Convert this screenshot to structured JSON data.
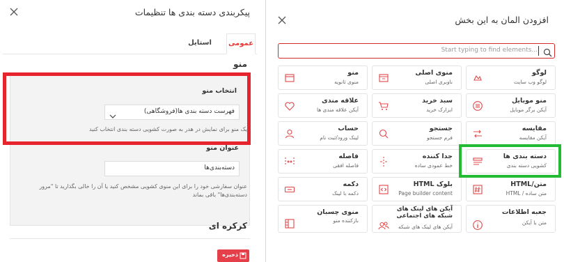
{
  "left_panel": {
    "title": "پیکربندی دسته بندی ها تنظیمات",
    "tabs": [
      {
        "label": "عمومی",
        "active": true
      },
      {
        "label": "استایل",
        "active": false
      }
    ],
    "menu_section": {
      "title": "منو",
      "select_label": "انتخاب منو",
      "select_value": "فهرست دسته بندی ها(فروشگاهی)",
      "select_help": "یک منو برای نمایش در هدر به صورت کشویی دسته بندی انتخاب کنید",
      "title_label": "عنوان منو",
      "title_value": "دسته‌بندی‌ها",
      "title_help": "عنوان سفارشی خود را برای این منوی کشویی مشخص کنید یا آن را خالی بگذارید تا \"مرور دسته‌بندی‌ها\" باقی بماند"
    },
    "hamburger_section": {
      "title": "کرکره ای"
    },
    "save_label": "ذخیره"
  },
  "right_panel": {
    "title": "افزودن المان به این بخش",
    "search": {
      "placeholder": "Start typing to find elements...",
      "value": ""
    },
    "elements": [
      {
        "title": "لوگو",
        "subtitle": "لوگو وب سایت",
        "icon": "logo-icon"
      },
      {
        "title": "منوی اصلی",
        "subtitle": "ناوبری اصلی",
        "icon": "main-menu-icon"
      },
      {
        "title": "منو",
        "subtitle": "منوی ثانویه",
        "icon": "menu-icon"
      },
      {
        "title": "منو موبایل",
        "subtitle": "آیکن برگر موبایل",
        "icon": "mobile-menu-icon"
      },
      {
        "title": "سبد خرید",
        "subtitle": "ابزارک خرید",
        "icon": "cart-icon"
      },
      {
        "title": "علاقه مندی",
        "subtitle": "آیکن علاقه مندی ها",
        "icon": "heart-icon"
      },
      {
        "title": "مقایسه",
        "subtitle": "آیکن مقایسه",
        "icon": "compare-icon"
      },
      {
        "title": "جستجو",
        "subtitle": "فرم جستجو",
        "icon": "search-icon"
      },
      {
        "title": "حساب",
        "subtitle": "لینک ورود/ثبت نام",
        "icon": "user-icon"
      },
      {
        "title": "دسته بندی ها",
        "subtitle": "کشویی دسته بندی",
        "icon": "categories-icon"
      },
      {
        "title": "جدا کننده",
        "subtitle": "خط عمودی ساده",
        "icon": "divider-icon"
      },
      {
        "title": "فاصله",
        "subtitle": "فاصله افقی",
        "icon": "spacer-icon"
      },
      {
        "title": "متن/HTML",
        "subtitle": "متن ساده / HTML",
        "icon": "text-html-icon"
      },
      {
        "title": "بلوک HTML",
        "subtitle": "Page builder content",
        "icon": "html-block-icon"
      },
      {
        "title": "دکمه",
        "subtitle": "دکمه با لینک",
        "icon": "button-icon"
      },
      {
        "title": "جعبه اطلاعات",
        "subtitle": "متن با آیکن",
        "icon": "info-icon"
      },
      {
        "title": "آیکن های لینک های شبکه های اجتماعی",
        "subtitle": "آیکن های لینک های شبکه",
        "icon": "social-icon"
      },
      {
        "title": "منوی چسبان",
        "subtitle": "بازکننده منو",
        "icon": "sticky-menu-icon"
      }
    ]
  },
  "colors": {
    "accent": "#e5242e",
    "highlight_red": "#e5242e",
    "highlight_green": "#22bb33",
    "icon": "#e04848"
  }
}
